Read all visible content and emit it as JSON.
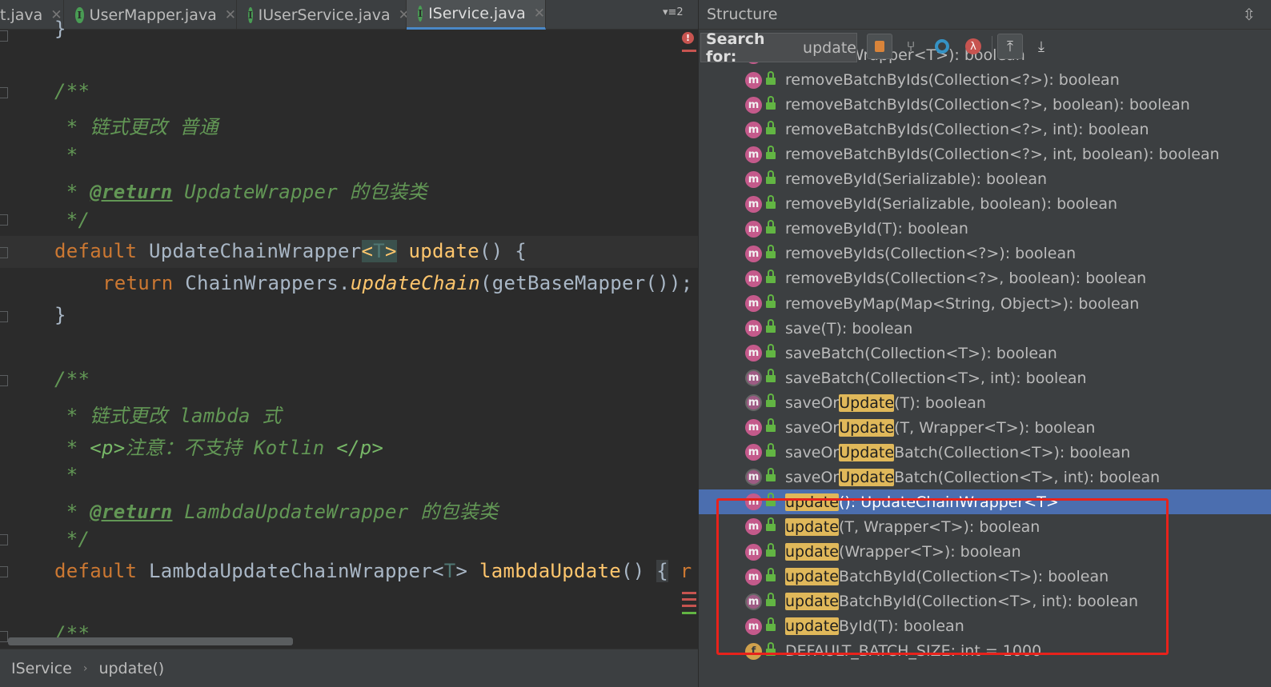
{
  "tabs": [
    {
      "label": "t.java",
      "active": false
    },
    {
      "label": "UserMapper.java",
      "active": false
    },
    {
      "label": "IUserService.java",
      "active": false
    },
    {
      "label": "IService.java",
      "active": true
    }
  ],
  "tab_list_count": "2",
  "editor": {
    "lines": {
      "l0": "}",
      "l1": "/**",
      "l2": " * 链式更改 普通",
      "l3": " *",
      "l4_star": " * ",
      "l4_tag": "@return",
      "l4_rest": " UpdateWrapper 的包装类",
      "l5": " */",
      "l6_kw": "default",
      "l6_type": " UpdateChainWrapper",
      "l6_lt": "<",
      "l6_t": "T",
      "l6_gt": ">",
      "l6_fn": "update",
      "l6_rest": "() {",
      "l7_kw": "return",
      "l7_a": " ChainWrappers.",
      "l7_fn": "updateChain",
      "l7_rest": "(getBaseMapper());",
      "l8": "}",
      "l9": "/**",
      "l10": " * 链式更改 lambda 式",
      "l11_star": " * ",
      "l11_p1": "<p>",
      "l11_mid": "注意：不支持 Kotlin ",
      "l11_p2": "</p>",
      "l12": " *",
      "l13_star": " * ",
      "l13_tag": "@return",
      "l13_rest": " LambdaUpdateWrapper 的包装类",
      "l14": " */",
      "l15_kw": "default",
      "l15_type": " LambdaUpdateChainWrapper<",
      "l15_t": "T",
      "l15_gt": "> ",
      "l15_fn": "lambdaUpdate",
      "l15_rest": "() ",
      "l15_brace": "{",
      "l15_tail": " r",
      "l16": "/**"
    }
  },
  "breadcrumb": [
    "IService",
    "update()"
  ],
  "structure": {
    "title": "Structure",
    "search_label": "Search for:",
    "search_value": "update",
    "items": [
      {
        "icon": "m",
        "pre": "remove(Wrapper<T>): boolean",
        "hl": "",
        "post": ""
      },
      {
        "icon": "m",
        "pre": "removeBatchByIds(Collection<?>): boolean",
        "hl": "",
        "post": ""
      },
      {
        "icon": "m",
        "pre": "removeBatchByIds(Collection<?>, boolean): boolean",
        "hl": "",
        "post": ""
      },
      {
        "icon": "m",
        "pre": "removeBatchByIds(Collection<?>, int): boolean",
        "hl": "",
        "post": ""
      },
      {
        "icon": "m",
        "pre": "removeBatchByIds(Collection<?>, int, boolean): boolean",
        "hl": "",
        "post": ""
      },
      {
        "icon": "m",
        "pre": "removeById(Serializable): boolean",
        "hl": "",
        "post": ""
      },
      {
        "icon": "m",
        "pre": "removeById(Serializable, boolean): boolean",
        "hl": "",
        "post": ""
      },
      {
        "icon": "m",
        "pre": "removeById(T): boolean",
        "hl": "",
        "post": ""
      },
      {
        "icon": "m",
        "pre": "removeByIds(Collection<?>): boolean",
        "hl": "",
        "post": ""
      },
      {
        "icon": "m",
        "pre": "removeByIds(Collection<?>, boolean): boolean",
        "hl": "",
        "post": ""
      },
      {
        "icon": "m",
        "pre": "removeByMap(Map<String, Object>): boolean",
        "hl": "",
        "post": ""
      },
      {
        "icon": "m",
        "pre": "save(T): boolean",
        "hl": "",
        "post": ""
      },
      {
        "icon": "m",
        "pre": "saveBatch(Collection<T>): boolean",
        "hl": "",
        "post": ""
      },
      {
        "icon": "m-abs",
        "pre": "saveBatch(Collection<T>, int): boolean",
        "hl": "",
        "post": ""
      },
      {
        "icon": "m-abs",
        "pre": "saveOr",
        "hl": "Update",
        "post": "(T): boolean"
      },
      {
        "icon": "m",
        "pre": "saveOr",
        "hl": "Update",
        "post": "(T, Wrapper<T>): boolean"
      },
      {
        "icon": "m",
        "pre": "saveOr",
        "hl": "Update",
        "post": "Batch(Collection<T>): boolean"
      },
      {
        "icon": "m-abs",
        "pre": "saveOr",
        "hl": "Update",
        "post": "Batch(Collection<T>, int): boolean"
      },
      {
        "icon": "m",
        "pre": "",
        "hl": "update",
        "post": "(): UpdateChainWrapper<T>",
        "selected": true
      },
      {
        "icon": "m",
        "pre": "",
        "hl": "update",
        "post": "(T, Wrapper<T>): boolean"
      },
      {
        "icon": "m",
        "pre": "",
        "hl": "update",
        "post": "(Wrapper<T>): boolean"
      },
      {
        "icon": "m",
        "pre": "",
        "hl": "update",
        "post": "BatchById(Collection<T>): boolean"
      },
      {
        "icon": "m-abs",
        "pre": "",
        "hl": "update",
        "post": "BatchById(Collection<T>, int): boolean"
      },
      {
        "icon": "m",
        "pre": "",
        "hl": "update",
        "post": "ById(T): boolean"
      },
      {
        "icon": "f",
        "pre": "DEFAULT_BATCH_SIZE: int = 1000",
        "hl": "",
        "post": ""
      }
    ]
  },
  "colors": {
    "selection": "#4b6eaf",
    "match_highlight": "#e0b85a",
    "annotation_box": "#e8221b"
  }
}
